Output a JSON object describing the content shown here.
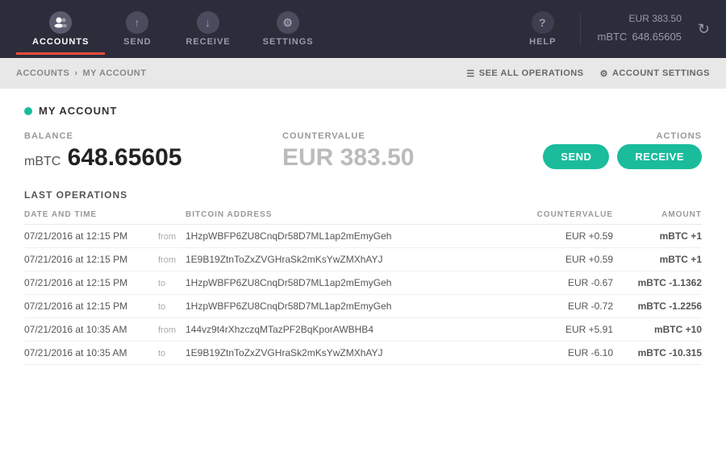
{
  "nav": {
    "items": [
      {
        "id": "accounts",
        "label": "ACCOUNTS",
        "icon": "👥",
        "active": true
      },
      {
        "id": "send",
        "label": "SEND",
        "icon": "↑",
        "active": false
      },
      {
        "id": "receive",
        "label": "RECEIVE",
        "icon": "↓",
        "active": false
      },
      {
        "id": "settings",
        "label": "SETTINGS",
        "icon": "⚙",
        "active": false
      }
    ],
    "help": {
      "label": "HELP",
      "icon": "?"
    },
    "balance_eur": "EUR 383.50",
    "balance_mbtc_unit": "mBTC",
    "balance_mbtc_value": "648.65605",
    "refresh_icon": "↻"
  },
  "breadcrumb": {
    "root": "ACCOUNTS",
    "current": "MY ACCOUNT",
    "see_all_label": "SEE ALL OPERATIONS",
    "account_settings_label": "ACCOUNT SETTINGS",
    "list_icon": "☰",
    "gear_icon": "⚙"
  },
  "account": {
    "dot_color": "#1abc9c",
    "title": "MY ACCOUNT",
    "balance_label": "BALANCE",
    "balance_unit": "mBTC",
    "balance_value": "648.65605",
    "countervalue_label": "COUNTERVALUE",
    "countervalue_value": "EUR 383.50",
    "actions_label": "ACTIONS",
    "send_label": "SEND",
    "receive_label": "RECEIVE"
  },
  "operations": {
    "title": "LAST OPERATIONS",
    "columns": {
      "datetime": "DATE AND TIME",
      "address": "BITCOIN ADDRESS",
      "countervalue": "COUNTERVALUE",
      "amount": "AMOUNT"
    },
    "rows": [
      {
        "datetime": "07/21/2016 at 12:15 PM",
        "direction": "from",
        "address": "1HzpWBFP6ZU8CnqDr58D7ML1ap2mEmyGeh",
        "countervalue": "EUR +0.59",
        "amount": "mBTC +1",
        "amount_type": "positive"
      },
      {
        "datetime": "07/21/2016 at 12:15 PM",
        "direction": "from",
        "address": "1E9B19ZtnToZxZVGHraSk2mKsYwZMXhAYJ",
        "countervalue": "EUR +0.59",
        "amount": "mBTC +1",
        "amount_type": "positive"
      },
      {
        "datetime": "07/21/2016 at 12:15 PM",
        "direction": "to",
        "address": "1HzpWBFP6ZU8CnqDr58D7ML1ap2mEmyGeh",
        "countervalue": "EUR -0.67",
        "amount": "mBTC -1.1362",
        "amount_type": "negative"
      },
      {
        "datetime": "07/21/2016 at 12:15 PM",
        "direction": "to",
        "address": "1HzpWBFP6ZU8CnqDr58D7ML1ap2mEmyGeh",
        "countervalue": "EUR -0.72",
        "amount": "mBTC -1.2256",
        "amount_type": "negative"
      },
      {
        "datetime": "07/21/2016 at 10:35 AM",
        "direction": "from",
        "address": "144vz9t4rXhzczqMTazPF2BqKporAWBHB4",
        "countervalue": "EUR +5.91",
        "amount": "mBTC +10",
        "amount_type": "positive"
      },
      {
        "datetime": "07/21/2016 at 10:35 AM",
        "direction": "to",
        "address": "1E9B19ZtnToZxZVGHraSk2mKsYwZMXhAYJ",
        "countervalue": "EUR -6.10",
        "amount": "mBTC -10.315",
        "amount_type": "negative"
      }
    ]
  }
}
